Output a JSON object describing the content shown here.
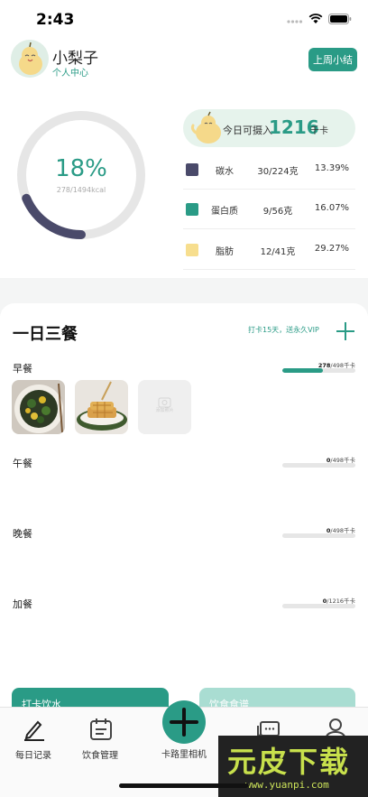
{
  "status_bar": {
    "time": "2:43"
  },
  "header": {
    "user_name": "小梨子",
    "subtitle": "个人中心",
    "weekly_button": "上周小结"
  },
  "summary": {
    "percent_text": "18%",
    "progress_fraction": 0.186,
    "kcal_progress": "278/1494kcal",
    "intake_label": "今日可摄入",
    "intake_value": "1216",
    "intake_unit": "千卡"
  },
  "nutrients": [
    {
      "name": "碳水",
      "amount": "30/224克",
      "percent": "13.39%",
      "color": "#4a4a6a"
    },
    {
      "name": "蛋白质",
      "amount": "9/56克",
      "percent": "16.07%",
      "color": "#2a9b86"
    },
    {
      "name": "脂肪",
      "amount": "12/41克",
      "percent": "29.27%",
      "color": "#f7de8e"
    }
  ],
  "meals_section": {
    "title": "一日三餐",
    "promo": "打卡15天，送永久VIP",
    "meals": [
      {
        "name": "早餐",
        "current": "278",
        "total": "/498千卡",
        "fraction": 0.56
      },
      {
        "name": "午餐",
        "current": "0",
        "total": "/498千卡",
        "fraction": 0
      },
      {
        "name": "晚餐",
        "current": "0",
        "total": "/498千卡",
        "fraction": 0
      },
      {
        "name": "加餐",
        "current": "0",
        "total": "/1216千卡",
        "fraction": 0
      }
    ],
    "add_photo_label": "添加照片"
  },
  "cards": {
    "water": "打卡饮水",
    "recipe": "饮食食谱"
  },
  "tabs": [
    {
      "label": "每日记录",
      "icon": "pen-icon"
    },
    {
      "label": "饮食管理",
      "icon": "calendar-icon"
    },
    {
      "label": "卡路里相机",
      "icon": "plus-icon"
    },
    {
      "label": "社区",
      "icon": "chat-icon"
    },
    {
      "label": "我的",
      "icon": "person-icon"
    }
  ],
  "watermark": {
    "title": "元皮下载",
    "url": "www.yuanpi.com"
  },
  "colors": {
    "accent": "#2a9b86",
    "ring_progress": "#4a4a6a",
    "ring_track": "#e6e6e6"
  }
}
